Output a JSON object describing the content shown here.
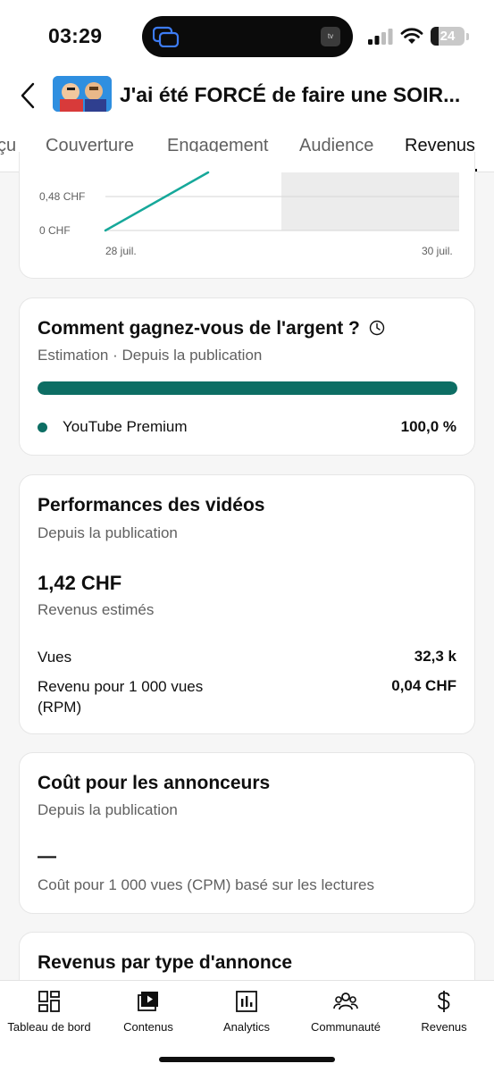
{
  "status_bar": {
    "time": "03:29",
    "island_app": "tv",
    "battery_level": "24",
    "battery_percent": 24
  },
  "header": {
    "video_title": "J'ai été FORCÉ de faire une SOIR...",
    "back_icon": "chevron-left-icon",
    "thumbnail_icon": "video-thumbnail"
  },
  "tabs": [
    {
      "label": "çu",
      "active": false
    },
    {
      "label": "Couverture",
      "active": false
    },
    {
      "label": "Engagement",
      "active": false
    },
    {
      "label": "Audience",
      "active": false
    },
    {
      "label": "Revenus",
      "active": true
    }
  ],
  "chart": {
    "y_ticks": [
      "0,48 CHF",
      "0 CHF"
    ],
    "x_ticks": [
      "28 juil.",
      "30 juil."
    ],
    "line_color": "#16a89a"
  },
  "earnings_card": {
    "title": "Comment gagnez-vous de l'argent ?",
    "subtitle": "Estimation · Depuis la publication",
    "bar_fraction": 1.0,
    "bar_color": "#0d6e64",
    "legend_label": "YouTube Premium",
    "legend_value": "100,0 %"
  },
  "performance_card": {
    "title": "Performances des vidéos",
    "subtitle": "Depuis la publication",
    "big_value": "1,42 CHF",
    "big_label": "Revenus estimés",
    "rows": [
      {
        "label": "Vues",
        "value": "32,3 k"
      },
      {
        "label_line1": "Revenu pour 1 000 vues",
        "label_line2": "(RPM)",
        "value": "0,04 CHF"
      }
    ]
  },
  "advertiser_card": {
    "title": "Coût pour les annonceurs",
    "subtitle": "Depuis la publication",
    "value": "—",
    "label": "Coût pour 1 000 vues (CPM) basé sur les lectures"
  },
  "ad_type_card": {
    "title": "Revenus par type d'annonce"
  },
  "bottom_nav": [
    {
      "label": "Tableau de bord",
      "icon": "dashboard-icon"
    },
    {
      "label": "Contenus",
      "icon": "content-icon"
    },
    {
      "label": "Analytics",
      "icon": "analytics-icon"
    },
    {
      "label": "Communauté",
      "icon": "community-icon"
    },
    {
      "label": "Revenus",
      "icon": "dollar-icon"
    }
  ]
}
